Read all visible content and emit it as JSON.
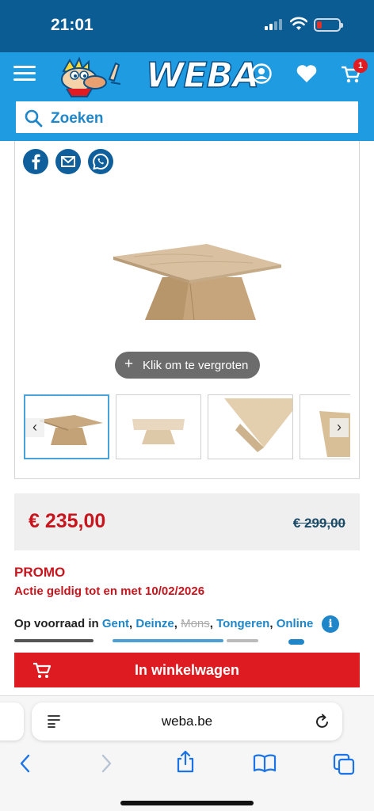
{
  "status_bar": {
    "time": "21:01",
    "battery_color": "#e0312b"
  },
  "header": {
    "brand": "WEBA",
    "cart_count": "1",
    "search_placeholder": "Zoeken",
    "colors": {
      "header_bg": "#1f9be2",
      "statusbar_bg": "#0a5c93"
    }
  },
  "product": {
    "share_icons": [
      "facebook-icon",
      "email-icon",
      "whatsapp-icon"
    ],
    "zoom_label": "Klik om te vergroten",
    "thumbnail_count": 4,
    "price": "€ 235,00",
    "old_price": "€ 299,00",
    "promo_title": "PROMO",
    "promo_valid": "Actie geldig tot en met 10/02/2026",
    "stock": {
      "prefix": "Op voorraad in",
      "locations": [
        {
          "name": "Gent",
          "available": true
        },
        {
          "name": "Deinze",
          "available": true
        },
        {
          "name": "Mons",
          "available": false
        },
        {
          "name": "Tongeren",
          "available": true
        },
        {
          "name": "Online",
          "available": true
        }
      ]
    },
    "add_to_cart_label": "In winkelwagen",
    "accent_red": "#c8151d",
    "accent_blue": "#1f87c9"
  },
  "browser": {
    "url": "weba.be"
  }
}
